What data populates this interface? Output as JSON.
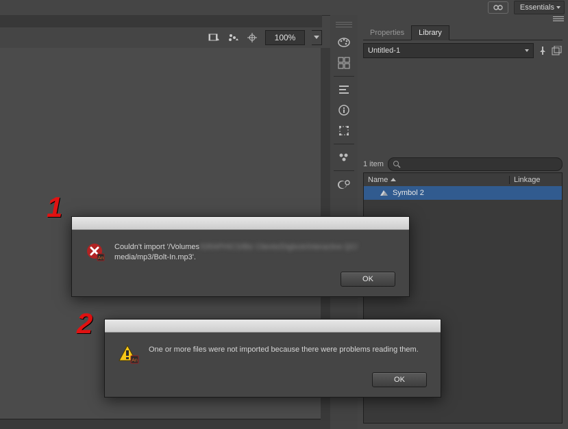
{
  "topbar": {
    "workspace_label": "Essentials"
  },
  "toolbar": {
    "zoom_value": "100%"
  },
  "panels": {
    "tabs": {
      "properties": "Properties",
      "library": "Library"
    },
    "doc_select": "Untitled-1",
    "items_count": "1 item",
    "search_placeholder": "",
    "columns": {
      "name": "Name",
      "linkage": "Linkage"
    },
    "rows": [
      {
        "name": "Symbol 2"
      }
    ]
  },
  "annotations": {
    "one": "1",
    "two": "2"
  },
  "dialog1": {
    "line1_prefix": "Couldn't import '/Volumes",
    "line1_blur": "/GRAPHICS/Biz Clients/Diglock/Interactive QC/",
    "line2": "media/mp3/Bolt-In.mp3'.",
    "ok": "OK"
  },
  "dialog2": {
    "message": "One or more files were not imported because there were problems reading them.",
    "ok": "OK"
  }
}
